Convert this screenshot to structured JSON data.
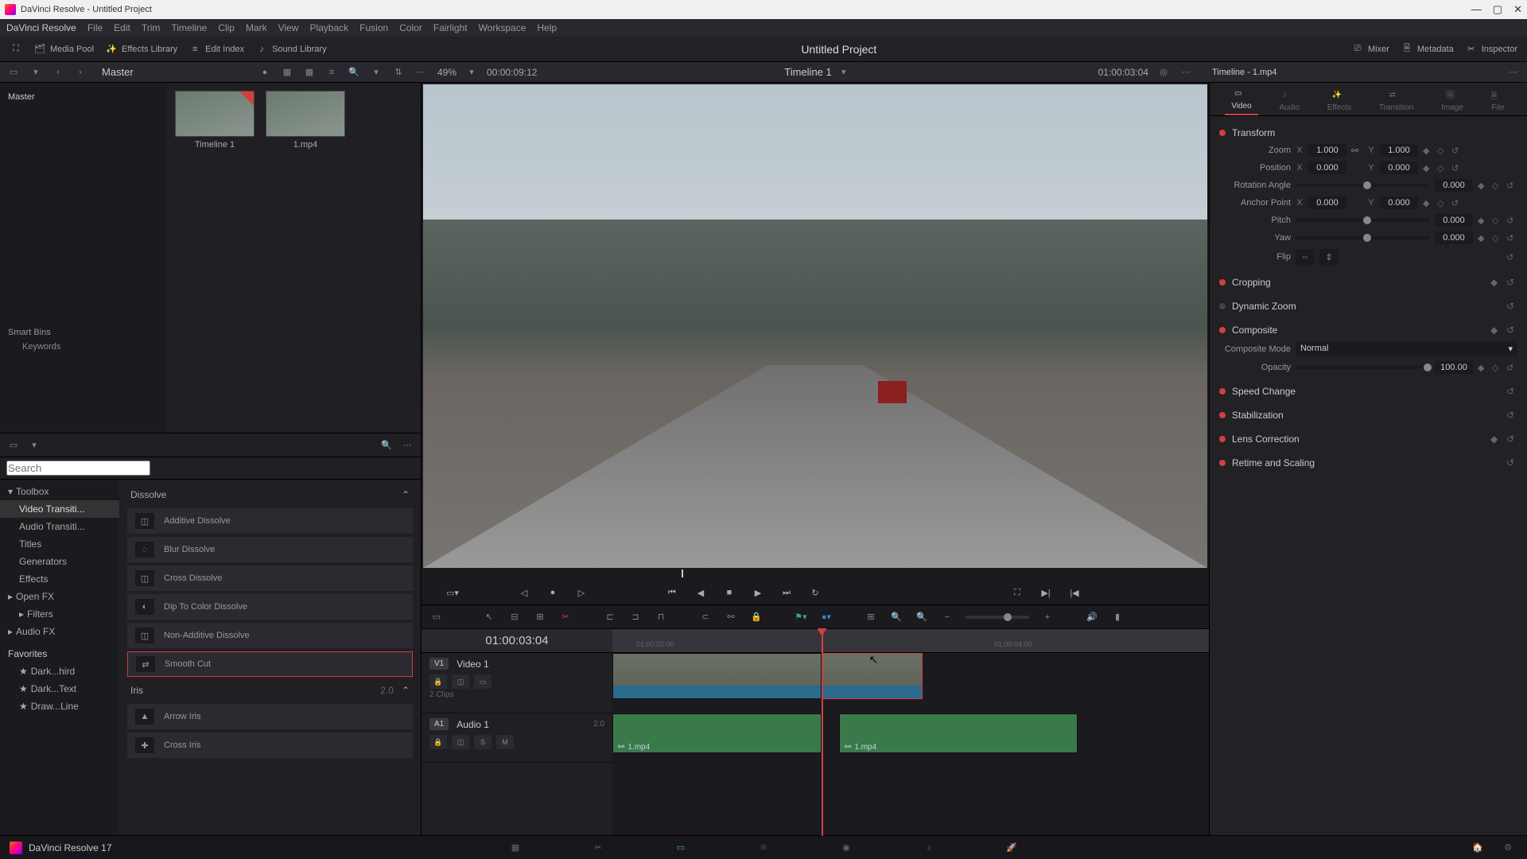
{
  "titlebar": {
    "title": "DaVinci Resolve - Untitled Project"
  },
  "menubar": [
    "DaVinci Resolve",
    "File",
    "Edit",
    "Trim",
    "Timeline",
    "Clip",
    "Mark",
    "View",
    "Playback",
    "Fusion",
    "Color",
    "Fairlight",
    "Workspace",
    "Help"
  ],
  "maintoolbar": {
    "left": [
      {
        "label": "Media Pool"
      },
      {
        "label": "Effects Library"
      },
      {
        "label": "Edit Index"
      },
      {
        "label": "Sound Library"
      }
    ],
    "project": "Untitled Project",
    "right": [
      {
        "label": "Mixer"
      },
      {
        "label": "Metadata"
      },
      {
        "label": "Inspector"
      }
    ]
  },
  "subtoolbar": {
    "master": "Master",
    "zoom_pct": "49%",
    "source_tc": "00:00:09:12",
    "timeline_name": "Timeline 1",
    "record_tc": "01:00:03:04",
    "clip_name": "Timeline - 1.mp4"
  },
  "mediapool": {
    "master": "Master",
    "smart_bins": "Smart Bins",
    "keywords": "Keywords",
    "thumbs": [
      {
        "label": "Timeline 1"
      },
      {
        "label": "1.mp4"
      }
    ]
  },
  "effects": {
    "search_placeholder": "Search",
    "tree": [
      {
        "label": "Toolbox",
        "parent": true
      },
      {
        "label": "Video Transiti...",
        "child": true,
        "sel": true
      },
      {
        "label": "Audio Transiti...",
        "child": true
      },
      {
        "label": "Titles",
        "child": true
      },
      {
        "label": "Generators",
        "child": true
      },
      {
        "label": "Effects",
        "child": true
      },
      {
        "label": "Open FX",
        "parent": true
      },
      {
        "label": "Filters",
        "child": true
      },
      {
        "label": "Audio FX",
        "parent": true
      }
    ],
    "favorites_header": "Favorites",
    "favorites": [
      "Dark...hird",
      "Dark...Text",
      "Draw...Line"
    ],
    "group1": "Dissolve",
    "items1": [
      "Additive Dissolve",
      "Blur Dissolve",
      "Cross Dissolve",
      "Dip To Color Dissolve",
      "Non-Additive Dissolve",
      "Smooth Cut"
    ],
    "selected_item": "Smooth Cut",
    "group2": "Iris",
    "group2_ver": "2.0",
    "items2": [
      "Arrow Iris",
      "Cross Iris"
    ]
  },
  "timeline": {
    "tc": "01:00:03:04",
    "ticks": [
      "01:00:02:00",
      "01:00:04:00"
    ],
    "tracks": {
      "video": {
        "badge": "V1",
        "name": "Video 1",
        "clips_sub": "2 Clips"
      },
      "audio": {
        "badge": "A1",
        "name": "Audio 1",
        "meter": "2.0"
      }
    },
    "clip_name": "1.mp4"
  },
  "inspector": {
    "tabs": [
      "Video",
      "Audio",
      "Effects",
      "Transition",
      "Image",
      "File"
    ],
    "transform": {
      "header": "Transform",
      "zoom_label": "Zoom",
      "zoom_x": "1.000",
      "zoom_y": "1.000",
      "position_label": "Position",
      "pos_x": "0.000",
      "pos_y": "0.000",
      "rotation_label": "Rotation Angle",
      "rotation": "0.000",
      "anchor_label": "Anchor Point",
      "anchor_x": "0.000",
      "anchor_y": "0.000",
      "pitch_label": "Pitch",
      "pitch": "0.000",
      "yaw_label": "Yaw",
      "yaw": "0.000",
      "flip_label": "Flip"
    },
    "cropping_header": "Cropping",
    "dynzoom_header": "Dynamic Zoom",
    "composite": {
      "header": "Composite",
      "mode_label": "Composite Mode",
      "mode": "Normal",
      "opacity_label": "Opacity",
      "opacity": "100.00"
    },
    "speed_header": "Speed Change",
    "stab_header": "Stabilization",
    "lens_header": "Lens Correction",
    "retime_header": "Retime and Scaling"
  },
  "pagebar": {
    "app": "DaVinci Resolve 17"
  }
}
